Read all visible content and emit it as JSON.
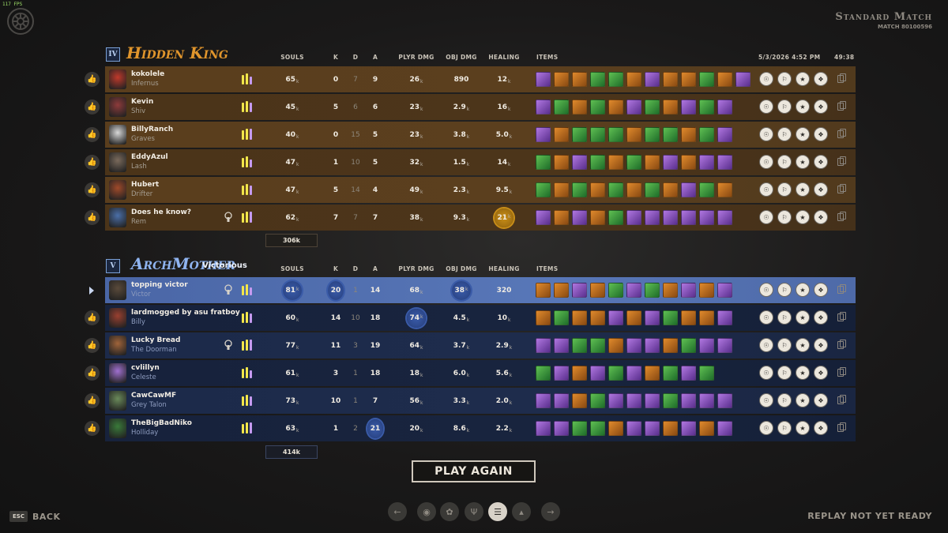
{
  "fps": "117 FPS",
  "header": {
    "match_type": "Standard Match",
    "match_id": "MATCH 80100596",
    "datetime": "5/3/2026 4:52 PM",
    "duration": "49:38"
  },
  "columns": {
    "souls": "SOULS",
    "k": "K",
    "d": "D",
    "a": "A",
    "plyr_dmg": "PLYR DMG",
    "obj_dmg": "OBJ DMG",
    "healing": "HEALING",
    "items": "ITEMS"
  },
  "teams": [
    {
      "name": "Hidden King",
      "rank": "IV",
      "status": "",
      "color": "#e0952c",
      "total_souls": "306k",
      "players": [
        {
          "name": "kokolele",
          "hero": "Infernus",
          "souls": "65",
          "k": "0",
          "d": "7",
          "a": "9",
          "plyr_dmg": "26",
          "obj_dmg": "890",
          "healing": "12",
          "avatar": "#c0392b"
        },
        {
          "name": "Kevin",
          "hero": "Shiv",
          "souls": "45",
          "k": "5",
          "d": "6",
          "a": "6",
          "plyr_dmg": "23",
          "obj_dmg": "2.9",
          "healing": "16",
          "avatar": "#8e3b3b"
        },
        {
          "name": "BillyRanch",
          "hero": "Graves",
          "souls": "40",
          "k": "0",
          "d": "15",
          "a": "5",
          "plyr_dmg": "23",
          "obj_dmg": "3.8",
          "healing": "5.0",
          "avatar": "#d8d8d8"
        },
        {
          "name": "EddyAzul",
          "hero": "Lash",
          "souls": "47",
          "k": "1",
          "d": "10",
          "a": "5",
          "plyr_dmg": "32",
          "obj_dmg": "1.5",
          "healing": "14",
          "avatar": "#7a6a5c"
        },
        {
          "name": "Hubert",
          "hero": "Drifter",
          "souls": "47",
          "k": "5",
          "d": "14",
          "a": "4",
          "plyr_dmg": "49",
          "obj_dmg": "2.3",
          "healing": "9.5",
          "avatar": "#a04a2a"
        },
        {
          "name": "Does he know?",
          "hero": "Rem",
          "souls": "62",
          "k": "7",
          "d": "7",
          "a": "7",
          "plyr_dmg": "38",
          "obj_dmg": "9.3",
          "healing": "21",
          "avatar": "#4b6fa8"
        }
      ]
    },
    {
      "name": "ArchMother",
      "rank": "V",
      "status": "Victorious",
      "color": "#8fb4f0",
      "total_souls": "414k",
      "players": [
        {
          "name": "topping victor",
          "hero": "Victor",
          "souls": "81",
          "k": "20",
          "d": "1",
          "a": "14",
          "plyr_dmg": "68",
          "obj_dmg": "38",
          "healing": "320",
          "avatar": "#5a4a3a"
        },
        {
          "name": "lardmogged by asu fratboy",
          "hero": "Billy",
          "souls": "60",
          "k": "14",
          "d": "10",
          "a": "18",
          "plyr_dmg": "74",
          "obj_dmg": "4.5",
          "healing": "10",
          "avatar": "#9a4030"
        },
        {
          "name": "Lucky Bread",
          "hero": "The Doorman",
          "souls": "77",
          "k": "11",
          "d": "3",
          "a": "19",
          "plyr_dmg": "64",
          "obj_dmg": "3.7",
          "healing": "2.9",
          "avatar": "#a0643a"
        },
        {
          "name": "cvlillyn",
          "hero": "Celeste",
          "souls": "61",
          "k": "3",
          "d": "1",
          "a": "18",
          "plyr_dmg": "18",
          "obj_dmg": "6.0",
          "healing": "5.6",
          "avatar": "#a070d0"
        },
        {
          "name": "CawCawMF",
          "hero": "Grey Talon",
          "souls": "73",
          "k": "10",
          "d": "1",
          "a": "7",
          "plyr_dmg": "56",
          "obj_dmg": "3.3",
          "healing": "2.0",
          "avatar": "#6a8a5a"
        },
        {
          "name": "TheBigBadNiko",
          "hero": "Holliday",
          "souls": "63",
          "k": "1",
          "d": "2",
          "a": "21",
          "plyr_dmg": "20",
          "obj_dmg": "8.6",
          "healing": "2.2",
          "avatar": "#3a7a3a"
        }
      ]
    }
  ],
  "play_again": "PLAY AGAIN",
  "footer": {
    "esc_key": "ESC",
    "back": "BACK",
    "replay_status": "REPLAY NOT YET READY"
  },
  "icons": {
    "logo": "wheel-logo-icon",
    "thumb": "thumbs-up-icon",
    "copy": "copy-icon",
    "lock": "keyhole-icon"
  }
}
